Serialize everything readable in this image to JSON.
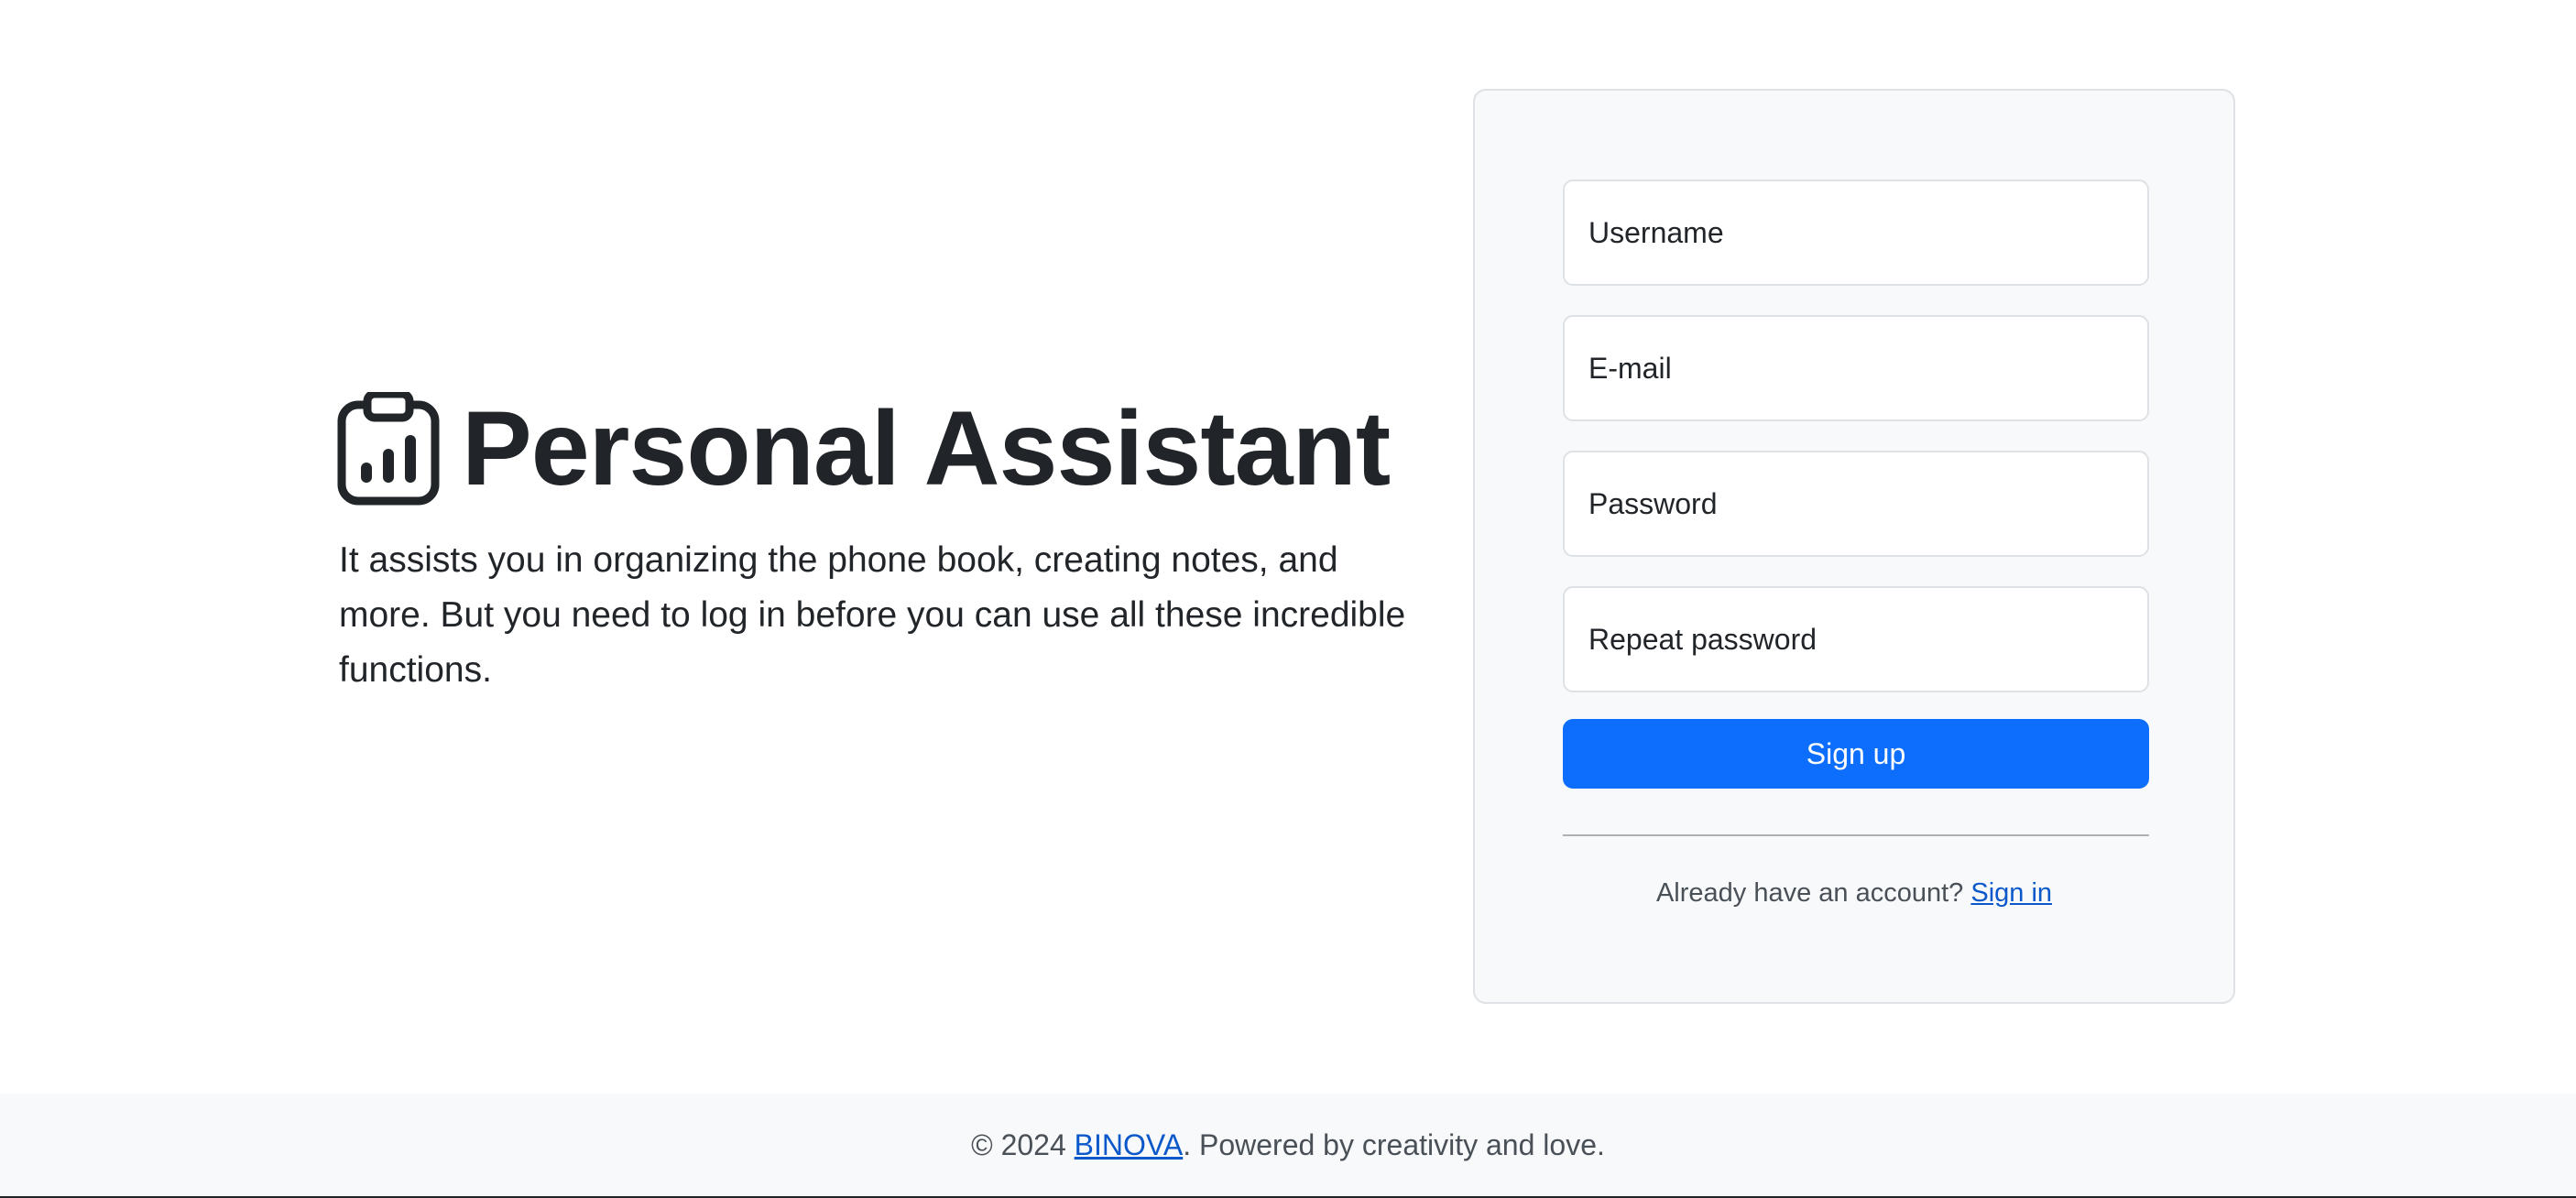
{
  "hero": {
    "icon": "clipboard-data-icon",
    "title": "Personal Assistant",
    "tagline": "It assists you in organizing the phone book, creating notes, and more. But you need to log in before you can use all these incredible functions."
  },
  "form": {
    "username_placeholder": "Username",
    "email_placeholder": "E-mail",
    "password_placeholder": "Password",
    "repeat_password_placeholder": "Repeat password",
    "submit_label": "Sign up",
    "signin_prompt": "Already have an account?",
    "signin_link": "Sign in"
  },
  "footer": {
    "copyright": "© 2024",
    "brand": "BINOVA",
    "suffix": ". Powered by creativity and love."
  },
  "colors": {
    "primary": "#0d6efd",
    "link": "#0a58ca",
    "text": "#212529",
    "muted": "#495057",
    "card_bg": "#f8f9fa",
    "border": "#dee2e6"
  }
}
